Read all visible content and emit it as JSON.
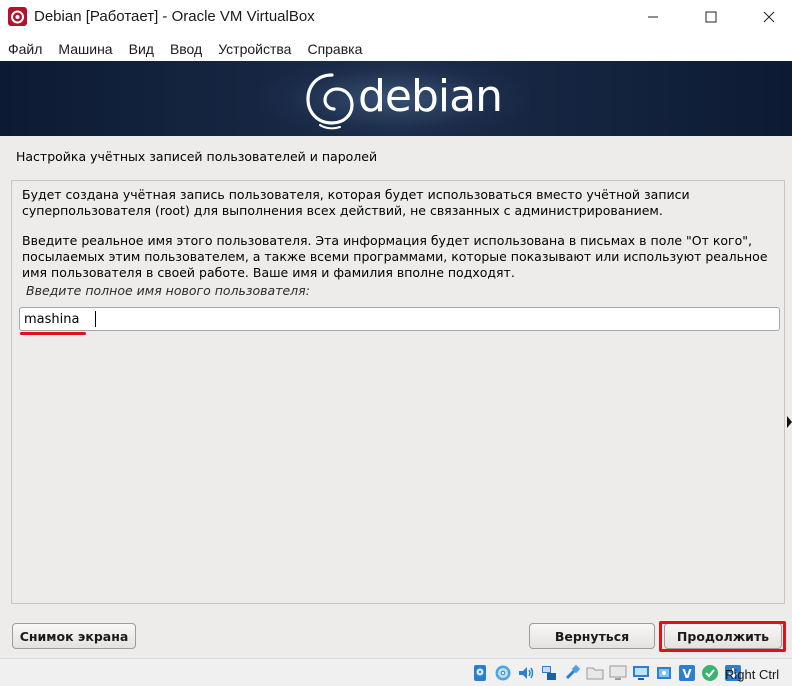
{
  "window": {
    "title": "Debian [Работает] - Oracle VM VirtualBox"
  },
  "menu": {
    "items": [
      {
        "label": "Файл"
      },
      {
        "label": "Машина"
      },
      {
        "label": "Вид"
      },
      {
        "label": "Ввод"
      },
      {
        "label": "Устройства"
      },
      {
        "label": "Справка"
      }
    ]
  },
  "banner": {
    "logo_text": "debian"
  },
  "installer": {
    "heading": "Настройка учётных записей пользователей и паролей",
    "paragraph_1": "Будет создана учётная запись пользователя, которая будет использоваться вместо учётной записи суперпользователя (root) для выполнения всех действий, не связанных с администрированием.",
    "paragraph_2": "Введите реальное имя этого пользователя. Эта информация будет использована в письмах в поле \"От кого\", посылаемых этим пользователем, а также всеми программами, которые показывают или используют реальное имя пользователя в своей работе. Ваше имя и фамилия вполне подходят.",
    "field_label": "Введите полное имя нового пользователя:",
    "field_value": "mashina",
    "buttons": {
      "screenshot": "Снимок экрана",
      "back": "Вернуться",
      "continue": "Продолжить"
    }
  },
  "statusbar": {
    "icons": [
      "hard-disk-icon",
      "optical-drive-icon",
      "audio-icon",
      "network-icon",
      "usb-icon",
      "shared-folders-icon",
      "display-icon",
      "screen-capture-icon",
      "capture-icon",
      "virtualization-icon",
      "mouse-integration-icon",
      "keyboard-icon"
    ],
    "host_key": "Right Ctrl"
  },
  "colors": {
    "banner_bg": "#0d1a33",
    "installer_bg": "#edeceb",
    "highlight": "#e0101c"
  }
}
